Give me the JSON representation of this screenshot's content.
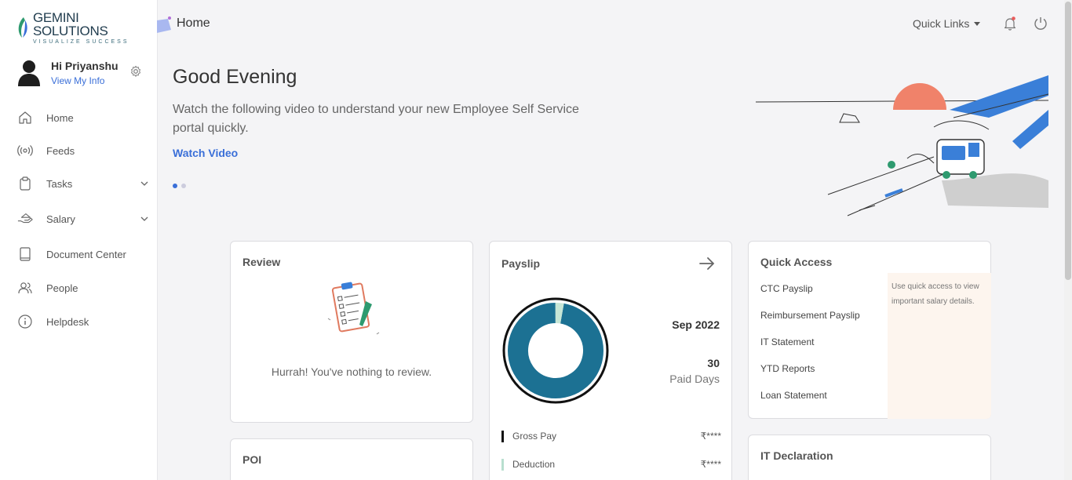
{
  "brand": {
    "name": "GEMINI SOLUTIONS",
    "tagline": "VISUALIZE SUCCESS",
    "colors": {
      "green": "#2e9a6f",
      "blue": "#3a6fd8",
      "teal": "#1c7193"
    }
  },
  "user": {
    "greeting": "Hi Priyanshu",
    "link": "View My Info"
  },
  "sidebar": {
    "items": [
      {
        "label": "Home",
        "icon": "home-icon",
        "expandable": false
      },
      {
        "label": "Feeds",
        "icon": "broadcast-icon",
        "expandable": false
      },
      {
        "label": "Tasks",
        "icon": "clipboard-icon",
        "expandable": true
      },
      {
        "label": "Salary",
        "icon": "hand-coin-icon",
        "expandable": true
      },
      {
        "label": "Document Center",
        "icon": "book-icon",
        "expandable": false
      },
      {
        "label": "People",
        "icon": "people-icon",
        "expandable": false
      },
      {
        "label": "Helpdesk",
        "icon": "info-icon",
        "expandable": false
      }
    ]
  },
  "header": {
    "title": "Home",
    "quick_links": "Quick Links"
  },
  "hero": {
    "greeting": "Good Evening",
    "description": "Watch the following video to understand your new Employee Self Service portal quickly.",
    "cta": "Watch Video",
    "slide_count": 2,
    "active_slide": 1
  },
  "review": {
    "title": "Review",
    "message": "Hurrah! You've nothing to review."
  },
  "poi": {
    "title": "POI"
  },
  "payslip": {
    "title": "Payslip",
    "month": "Sep 2022",
    "paid_days": "30",
    "paid_days_label": "Paid Days",
    "rows": [
      {
        "label": "Gross Pay",
        "value": "₹****",
        "color": "#111111"
      },
      {
        "label": "Deduction",
        "value": "₹****",
        "color": "#b8dfcf"
      }
    ],
    "chart": {
      "gross_fraction": 0.97,
      "deduction_fraction": 0.03,
      "gross_color": "#1c7193",
      "deduction_color": "#c7e6d6"
    }
  },
  "quick_access": {
    "title": "Quick Access",
    "items": [
      "CTC Payslip",
      "Reimbursement Payslip",
      "IT Statement",
      "YTD Reports",
      "Loan Statement"
    ],
    "note": "Use quick access to view important salary details."
  },
  "it_declaration": {
    "title": "IT Declaration"
  }
}
